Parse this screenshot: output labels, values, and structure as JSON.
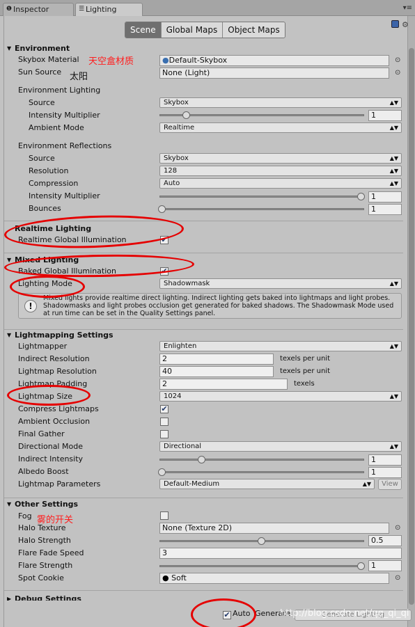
{
  "tabs": {
    "inspector": "Inspector",
    "lighting": "Lighting"
  },
  "modes": [
    "Scene",
    "Global Maps",
    "Object Maps"
  ],
  "environment": {
    "header": "Environment",
    "skybox_label": "Skybox Material",
    "skybox_value": "Default-Skybox",
    "sun_label": "Sun Source",
    "sun_value": "None (Light)",
    "env_lighting": "Environment Lighting",
    "source_label": "Source",
    "source_value": "Skybox",
    "intensity_label": "Intensity Multiplier",
    "intensity_value": "1",
    "ambient_label": "Ambient Mode",
    "ambient_value": "Realtime",
    "env_reflections": "Environment Reflections",
    "refl_source_label": "Source",
    "refl_source_value": "Skybox",
    "resolution_label": "Resolution",
    "resolution_value": "128",
    "compression_label": "Compression",
    "compression_value": "Auto",
    "refl_intensity_label": "Intensity Multiplier",
    "refl_intensity_value": "1",
    "bounces_label": "Bounces",
    "bounces_value": "1"
  },
  "realtime": {
    "header": "Realtime Lighting",
    "gi_label": "Realtime Global Illumination",
    "gi_checked": true
  },
  "mixed": {
    "header": "Mixed Lighting",
    "baked_label": "Baked Global Illumination",
    "baked_checked": true,
    "mode_label": "Lighting Mode",
    "mode_value": "Shadowmask",
    "info": "Mixed lights provide realtime direct lighting. Indirect lighting gets baked into lightmaps and light probes. Shadowmasks and light probes occlusion get generated for baked shadows. The Shadowmask Mode used at run time can be set in the Quality Settings panel."
  },
  "lightmapping": {
    "header": "Lightmapping Settings",
    "lightmapper_label": "Lightmapper",
    "lightmapper_value": "Enlighten",
    "indirect_res_label": "Indirect Resolution",
    "indirect_res_value": "2",
    "indirect_res_unit": "texels per unit",
    "lm_res_label": "Lightmap Resolution",
    "lm_res_value": "40",
    "lm_res_unit": "texels per unit",
    "padding_label": "Lightmap Padding",
    "padding_value": "2",
    "padding_unit": "texels",
    "size_label": "Lightmap Size",
    "size_value": "1024",
    "compress_label": "Compress Lightmaps",
    "compress_checked": true,
    "ao_label": "Ambient Occlusion",
    "final_gather_label": "Final Gather",
    "directional_label": "Directional Mode",
    "directional_value": "Directional",
    "indirect_int_label": "Indirect Intensity",
    "indirect_int_value": "1",
    "albedo_label": "Albedo Boost",
    "albedo_value": "1",
    "params_label": "Lightmap Parameters",
    "params_value": "Default-Medium",
    "view_label": "View"
  },
  "other": {
    "header": "Other Settings",
    "fog_label": "Fog",
    "halo_tex_label": "Halo Texture",
    "halo_tex_value": "None (Texture 2D)",
    "halo_str_label": "Halo Strength",
    "halo_str_value": "0.5",
    "flare_fade_label": "Flare Fade Speed",
    "flare_fade_value": "3",
    "flare_str_label": "Flare Strength",
    "flare_str_value": "1",
    "cookie_label": "Spot Cookie",
    "cookie_value": "Soft"
  },
  "debug": {
    "header": "Debug Settings"
  },
  "bottom": {
    "auto_label": "Auto",
    "generate_label": "Generate",
    "generate_button": "Generate Lighting",
    "watermark": "http://blog.csdn.net/qq_qi_qi"
  },
  "annotations": {
    "skybox_cn": "天空盒材质",
    "sun_cn": "太阳",
    "fog_cn": "雾的开关"
  },
  "colors": {
    "annotation": "#ff1e1e",
    "selected_segment": "#6f6f6f"
  }
}
